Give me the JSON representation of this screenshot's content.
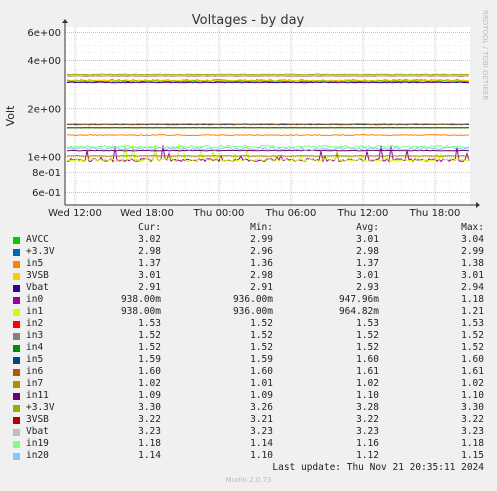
{
  "chart_data": {
    "type": "line",
    "title": "Voltages - by day",
    "ylabel": "Volt",
    "side_label": "RRDTOOL / TOBI OETIKER",
    "yscale": "log",
    "ylim": [
      0.5,
      6.5
    ],
    "yticks": [
      {
        "v": 6,
        "label": "6e+00"
      },
      {
        "v": 4,
        "label": "4e+00"
      },
      {
        "v": 2,
        "label": "2e+00"
      },
      {
        "v": 1,
        "label": "1e+00"
      },
      {
        "v": 0.8,
        "label": "8e-01"
      },
      {
        "v": 0.6,
        "label": "6e-01"
      }
    ],
    "xticks": [
      "Wed 12:00",
      "Wed 18:00",
      "Thu 00:00",
      "Thu 06:00",
      "Thu 12:00",
      "Thu 18:00"
    ],
    "grid": true,
    "columns": [
      "Cur:",
      "Min:",
      "Avg:",
      "Max:"
    ],
    "series": [
      {
        "name": "AVCC",
        "color": "#00cc00",
        "cur": "3.02",
        "min": "2.99",
        "avg": "3.01",
        "max": "3.04",
        "value": 3.01,
        "nmin": 2.99,
        "nmax": 3.04
      },
      {
        "name": "+3.3V",
        "color": "#0066b3",
        "cur": "2.98",
        "min": "2.96",
        "avg": "2.98",
        "max": "2.99",
        "value": 2.98,
        "nmin": 2.96,
        "nmax": 2.99
      },
      {
        "name": "in5",
        "color": "#ff8000",
        "cur": "1.37",
        "min": "1.36",
        "avg": "1.37",
        "max": "1.38",
        "value": 1.37,
        "nmin": 1.36,
        "nmax": 1.38
      },
      {
        "name": "3VSB",
        "color": "#ffcc00",
        "cur": "3.01",
        "min": "2.98",
        "avg": "3.01",
        "max": "3.01",
        "value": 3.01,
        "nmin": 2.98,
        "nmax": 3.01
      },
      {
        "name": "Vbat",
        "color": "#330099",
        "cur": "2.91",
        "min": "2.91",
        "avg": "2.93",
        "max": "2.94",
        "value": 2.93,
        "nmin": 2.91,
        "nmax": 2.94
      },
      {
        "name": "in0",
        "color": "#990099",
        "cur": "938.00m",
        "min": "936.00m",
        "avg": "947.96m",
        "max": "1.18",
        "value": 0.948,
        "nmin": 0.936,
        "nmax": 1.18
      },
      {
        "name": "in1",
        "color": "#ccff00",
        "cur": "938.00m",
        "min": "936.00m",
        "avg": "964.82m",
        "max": "1.21",
        "value": 0.965,
        "nmin": 0.936,
        "nmax": 1.21
      },
      {
        "name": "in2",
        "color": "#ff0000",
        "cur": "1.53",
        "min": "1.52",
        "avg": "1.53",
        "max": "1.53",
        "value": 1.53,
        "nmin": 1.52,
        "nmax": 1.53
      },
      {
        "name": "in3",
        "color": "#808080",
        "cur": "1.52",
        "min": "1.52",
        "avg": "1.52",
        "max": "1.52",
        "value": 1.52,
        "nmin": 1.52,
        "nmax": 1.52
      },
      {
        "name": "in4",
        "color": "#008f00",
        "cur": "1.52",
        "min": "1.52",
        "avg": "1.52",
        "max": "1.52",
        "value": 1.52,
        "nmin": 1.52,
        "nmax": 1.52
      },
      {
        "name": "in5",
        "color": "#00487d",
        "cur": "1.59",
        "min": "1.59",
        "avg": "1.60",
        "max": "1.60",
        "value": 1.6,
        "nmin": 1.59,
        "nmax": 1.6
      },
      {
        "name": "in6",
        "color": "#b35a00",
        "cur": "1.60",
        "min": "1.60",
        "avg": "1.61",
        "max": "1.61",
        "value": 1.61,
        "nmin": 1.6,
        "nmax": 1.61
      },
      {
        "name": "in7",
        "color": "#b38f00",
        "cur": "1.02",
        "min": "1.01",
        "avg": "1.02",
        "max": "1.02",
        "value": 1.02,
        "nmin": 1.01,
        "nmax": 1.02
      },
      {
        "name": "in11",
        "color": "#6b006b",
        "cur": "1.09",
        "min": "1.09",
        "avg": "1.10",
        "max": "1.10",
        "value": 1.1,
        "nmin": 1.09,
        "nmax": 1.1
      },
      {
        "name": "+3.3V",
        "color": "#8fb300",
        "cur": "3.30",
        "min": "3.26",
        "avg": "3.28",
        "max": "3.30",
        "value": 3.28,
        "nmin": 3.26,
        "nmax": 3.3
      },
      {
        "name": "3VSB",
        "color": "#b30000",
        "cur": "3.22",
        "min": "3.21",
        "avg": "3.22",
        "max": "3.22",
        "value": 3.22,
        "nmin": 3.21,
        "nmax": 3.22
      },
      {
        "name": "Vbat",
        "color": "#bebebe",
        "cur": "3.23",
        "min": "3.23",
        "avg": "3.23",
        "max": "3.23",
        "value": 3.23,
        "nmin": 3.23,
        "nmax": 3.23
      },
      {
        "name": "in19",
        "color": "#80ff80",
        "cur": "1.18",
        "min": "1.14",
        "avg": "1.16",
        "max": "1.18",
        "value": 1.16,
        "nmin": 1.14,
        "nmax": 1.18
      },
      {
        "name": "in20",
        "color": "#80c9ff",
        "cur": "1.14",
        "min": "1.10",
        "avg": "1.12",
        "max": "1.15",
        "value": 1.12,
        "nmin": 1.1,
        "nmax": 1.15
      }
    ]
  },
  "footer": {
    "last_update": "Last update: Thu Nov 21 20:35:11 2024",
    "version": "Munin 2.0.73"
  }
}
